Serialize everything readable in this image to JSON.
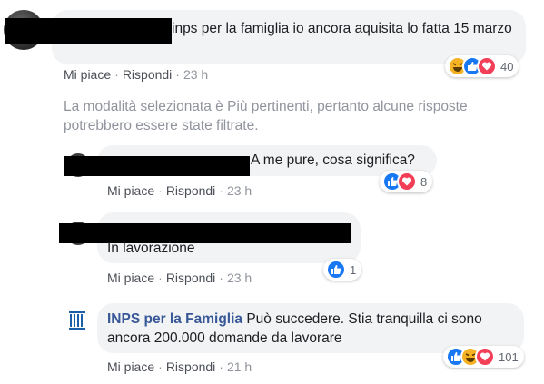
{
  "comments": [
    {
      "text": "inps per la famiglia io ancora aquisita lo fatta 15 marzo",
      "actions": {
        "like": "Mi piace",
        "reply": "Rispondi",
        "time": "23 h"
      },
      "reactions": {
        "icons": [
          "haha-icon",
          "like-icon",
          "love-icon"
        ],
        "count": "40"
      }
    }
  ],
  "notice": "La modalità selezionata è Più pertinenti, pertanto alcune risposte potrebbero essere state filtrate.",
  "replies": [
    {
      "text": "A me pure, cosa significa?",
      "actions": {
        "like": "Mi piace",
        "reply": "Rispondi",
        "time": "23 h"
      },
      "reactions": {
        "icons": [
          "like-icon",
          "love-icon"
        ],
        "count": "8"
      }
    },
    {
      "text": "In lavorazione",
      "actions": {
        "like": "Mi piace",
        "reply": "Rispondi",
        "time": "23 h"
      },
      "reactions": {
        "icons": [
          "like-icon"
        ],
        "count": "1"
      }
    },
    {
      "author": "INPS per la Famiglia",
      "text": "Può succedere. Stia tranquilla ci sono ancora 200.000 domande da lavorare",
      "logo": "INPS",
      "actions": {
        "like": "Mi piace",
        "reply": "Rispondi",
        "time": "21 h"
      },
      "reactions": {
        "icons": [
          "like-icon",
          "haha-icon",
          "love-icon"
        ],
        "count": "101"
      }
    }
  ],
  "colors": {
    "bubble": "#f2f3f5",
    "author": "#385898",
    "like": "#1877f2",
    "love": "#f33e58",
    "haha": "#f7b125",
    "muted": "#90949c"
  }
}
